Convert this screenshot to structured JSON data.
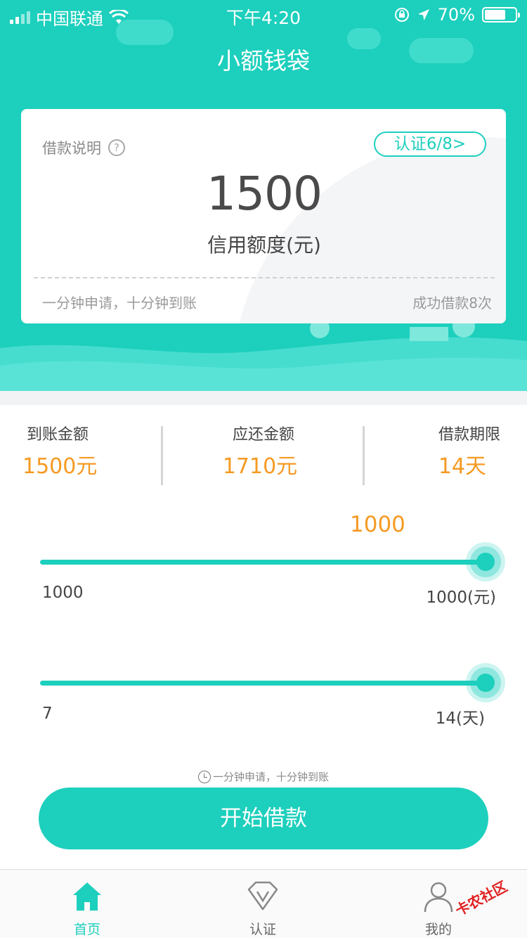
{
  "status_bar": {
    "carrier": "中国联通",
    "time": "下午4:20",
    "battery_percent": "70%",
    "battery_level": 0.7
  },
  "nav": {
    "title": "小额钱袋"
  },
  "card": {
    "loan_desc_label": "借款说明",
    "help_icon": "?",
    "cert_button": "认证6/8>",
    "amount": "1500",
    "amount_label": "信用额度(元)",
    "footer_left": "一分钟申请，十分钟到账",
    "footer_right": "成功借款8次"
  },
  "stats": [
    {
      "label": "到账金额",
      "value": "1500元"
    },
    {
      "label": "应还金额",
      "value": "1710元"
    },
    {
      "label": "借款期限",
      "value": "14天"
    }
  ],
  "amount_slider": {
    "current_value": "1000",
    "min_label": "1000",
    "max_label": "1000(元)",
    "fraction": 1.0
  },
  "term_slider": {
    "min_label": "7",
    "max_label": "14(天)",
    "fraction": 1.0
  },
  "hint": "一分钟申请，十分钟到账",
  "cta_button": "开始借款",
  "tabs": [
    {
      "label": "首页",
      "icon": "home-icon",
      "active": true
    },
    {
      "label": "认证",
      "icon": "verify-icon",
      "active": false
    },
    {
      "label": "我的",
      "icon": "profile-icon",
      "active": false
    }
  ],
  "watermark": "卡农社区",
  "colors": {
    "brand": "#1dcfbd",
    "accent_orange": "#f59a23"
  }
}
